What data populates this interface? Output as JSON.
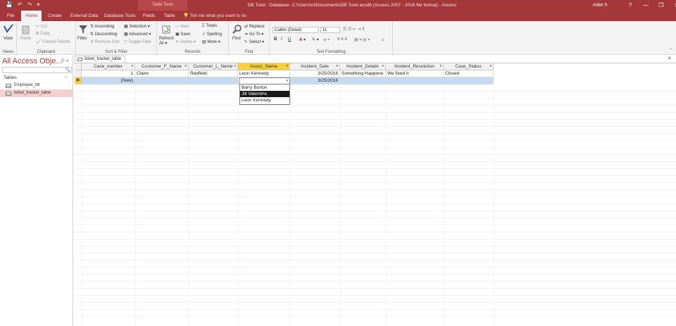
{
  "title_bar": {
    "qat": [
      "💾",
      "↶",
      "↷",
      "▾"
    ],
    "tool_context": "Table Tools",
    "title": "DB Tutor : Database- C:\\Users\\m\\Documents\\DB Tutor.accdb (Access 2007 - 2016 file format) - Access",
    "user": "mike h",
    "window_buttons": [
      "?",
      "—",
      "❐",
      "✕"
    ]
  },
  "ribbon_tabs": {
    "file": "File",
    "home": "Home",
    "create": "Create",
    "external": "External Data",
    "dbtools": "Database Tools",
    "fields": "Fields",
    "table": "Table",
    "tellme": "Tell me what you want to do"
  },
  "ribbon": {
    "views": {
      "view": "View",
      "label": "Views"
    },
    "clipboard": {
      "paste": "Paste",
      "cut": "Cut",
      "copy": "Copy",
      "format_painter": "Format Painter",
      "label": "Clipboard"
    },
    "sort_filter": {
      "filter": "Filter",
      "ascending": "Ascending",
      "descending": "Descending",
      "remove_sort": "Remove Sort",
      "selection": "Selection ▾",
      "advanced": "Advanced ▾",
      "toggle_filter": "Toggle Filter",
      "label": "Sort & Filter"
    },
    "records": {
      "refresh": "Refresh All ▾",
      "new": "New",
      "save": "Save",
      "delete": "Delete ▾",
      "totals": "Totals",
      "spelling": "Spelling",
      "more": "More ▾",
      "label": "Records"
    },
    "find": {
      "find": "Find",
      "replace": "Replace",
      "goto": "Go To ▾",
      "select": "Select ▾",
      "label": "Find"
    },
    "text_formatting": {
      "font": "Calibri (Detail)",
      "size": "11",
      "bold": "B",
      "italic": "I",
      "underline": "U",
      "label": "Text Formatting"
    }
  },
  "nav_pane": {
    "title": "All Access Obje...",
    "section": "Tables",
    "items": [
      "Employee_tbl",
      "ticket_tracker_table"
    ],
    "selected": 1
  },
  "document_tab": "ticket_tracker_table",
  "datasheet": {
    "columns": [
      "Case_number",
      "Customer_F_Name",
      "Customer_L_Name",
      "Assoc_Name",
      "Incident_Date",
      "Incident_Details",
      "Incident_Resolution",
      "Case_Status"
    ],
    "active_column": 3,
    "rows": [
      [
        "1",
        "Claire",
        "Redfield",
        "Leon Kennedy",
        "3/25/2016",
        "Something Happene",
        "We fixed it",
        "Closed"
      ]
    ],
    "new_row": [
      "(New)",
      "",
      "",
      "",
      "3/25/2016",
      "",
      "",
      ""
    ]
  },
  "combo_list": {
    "options": [
      "Barry Burton",
      "Jill Valentine",
      "Leon Kennedy"
    ],
    "highlighted": 1
  },
  "colors": {
    "accent": "#a4373a",
    "active_header": "#f8cf3e",
    "new_row": "#c6dbf1"
  }
}
